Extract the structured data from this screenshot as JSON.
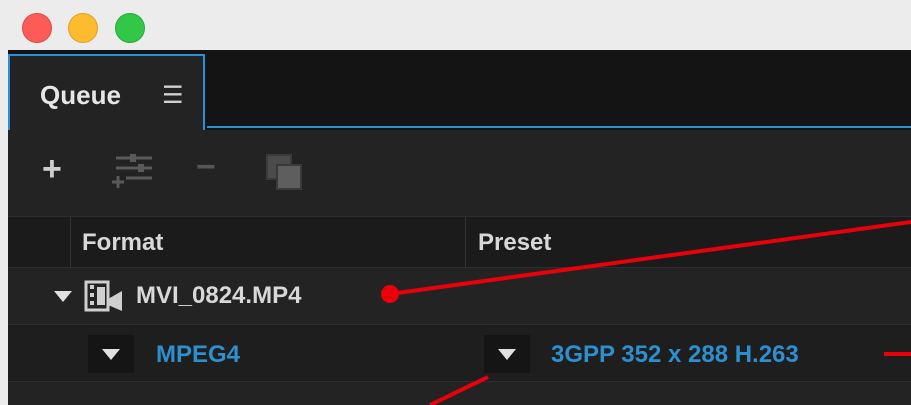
{
  "panel": {
    "tab_label": "Queue",
    "tab_menu_glyph": "☰"
  },
  "toolbar": {
    "add_glyph": "+",
    "remove_glyph": "−",
    "icons": [
      "plus-icon",
      "output-settings-icon",
      "minus-icon",
      "duplicate-icon"
    ]
  },
  "columns": {
    "format": "Format",
    "preset": "Preset"
  },
  "queue_item": {
    "file_name": "MVI_0824.MP4",
    "outputs": [
      {
        "format": "MPEG4",
        "preset": "3GPP 352 x 288 H.263"
      }
    ]
  },
  "colors": {
    "accent": "#2c8fd9",
    "link": "#2e8fcf",
    "annotation": "#e8000b",
    "panel_bg": "#232323"
  }
}
